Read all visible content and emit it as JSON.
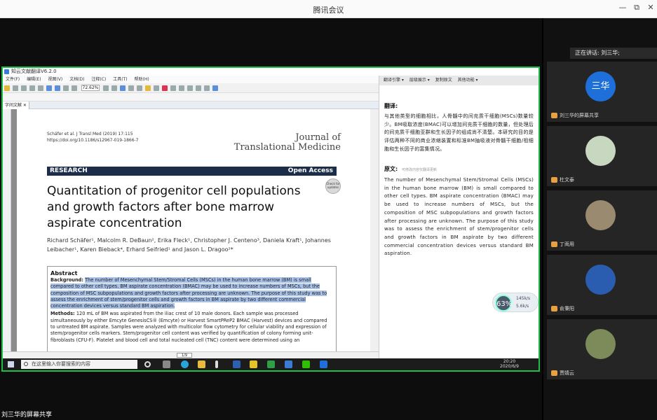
{
  "window": {
    "title": "腾讯会议",
    "controls": [
      "—",
      "⧉",
      "✕"
    ]
  },
  "app": {
    "title": "知云文献翻译V6.2.0",
    "menu": [
      "文件(F)",
      "编辑(E)",
      "视图(V)",
      "文档(D)",
      "注释(C)",
      "工具(T)",
      "帮助(H)"
    ],
    "zoom": "72.62%",
    "tab": "字间文献 ✕",
    "page_indicator": "1/9"
  },
  "paper": {
    "citation": "Schäfer et al. J Transl Med      (2019) 17:115",
    "doi": "https://doi.org/10.1186/s12967-019-1866-7",
    "journal_line1": "Journal of",
    "journal_line2": "Translational Medicine",
    "section": "RESEARCH",
    "access": "Open Access",
    "title": "Quantitation of progenitor cell populations and growth factors after bone marrow aspirate concentration",
    "badge": "Check for updates",
    "authors": "Richard Schäfer¹, Malcolm R. DeBaun², Erika Fleck¹, Christopher J. Centeno³, Daniela Kraft¹, Johannes Leibacher¹, Karen Bieback⁴, Erhard Seifried¹ and Jason L. Dragoo²*",
    "abstract_heading": "Abstract",
    "background_label": "Background:",
    "background_text": "The number of Mesenchymal Stem/Stromal Cells (MSCs) in the human bone marrow (BM) is small compared to other cell types. BM aspirate concentration (BMAC) may be used to increase numbers of MSCs, but the composition of MSC subpopulations and growth factors after processing are unknown. The purpose of this study was to assess the enrichment of stem/progenitor cells and growth factors in BM aspirate by two different commercial concentration devices versus standard BM aspiration.",
    "methods_label": "Methods:",
    "methods_text": "120 mL of BM was aspirated from the iliac crest of 10 male donors. Each sample was processed simultaneously by either Emcyte GenesisCS® (Emcyte) or Harvest SmartPReP2 BMAC (Harvest) devices and compared to untreated BM aspirate. Samples were analyzed with multicolor flow cytometry for cellular viability and expression of stem/progenitor cells markers. Stem/progenitor cell content was verified by quantification of colony forming unit-fibroblasts (CFU-F). Platelet and blood cell and total nucleated cell (TNC) content were determined using an"
  },
  "translate_panel": {
    "tabs": [
      "翻译引擎 ▾",
      "层级展示 ▾",
      "复制原文",
      "其他功能 ▾"
    ],
    "translation_label": "翻译:",
    "translation": "与其他类型的细胞相比，人骨髓中的间充质干细胞(MSCs)数量较少。BM吸取浓度(BMAC)可以增加间充质干细胞的数量，但处理后的间充质干细胞亚群和生长因子的组成尚不清楚。本研究的目的是评估两种不同的商业浓缩装置和标准BM抽吸液对骨髓干细胞/祖细胞和生长因子的富集情况。",
    "original_label": "原文:",
    "original_hint": "可修改内容仅翻译更新",
    "original": "The number of Mesenchymal Stem/Stromal Cells (MSCs) in the human bone marrow (BM) is small compared to other cell types. BM aspirate concentration (BMAC) may be used to increase numbers of MSCs, but the composition of MSC subpopulations and growth factors after processing are unknown. The purpose of this study was to assess the enrichment of stem/progenitor cells and growth factors in BM aspirate by two different commercial concentration devices versus standard BM aspiration."
  },
  "perf_widget": {
    "cpu": "63%",
    "up": "145k/s",
    "down": "5.6k/s"
  },
  "taskbar": {
    "search_placeholder": "在这里输入你要搜索的内容",
    "time": "20:20",
    "date": "2020/6/9"
  },
  "meeting": {
    "speaking": "正在讲话: 刘三华;",
    "participants": [
      {
        "name": "刘三华的屏幕共享",
        "avatar_text": "三华"
      },
      {
        "name": "杜文泰"
      },
      {
        "name": "丁両用"
      },
      {
        "name": "俞秉阳"
      },
      {
        "name": "贾婧云"
      }
    ],
    "share_label": "刘三华的屏幕共享"
  }
}
